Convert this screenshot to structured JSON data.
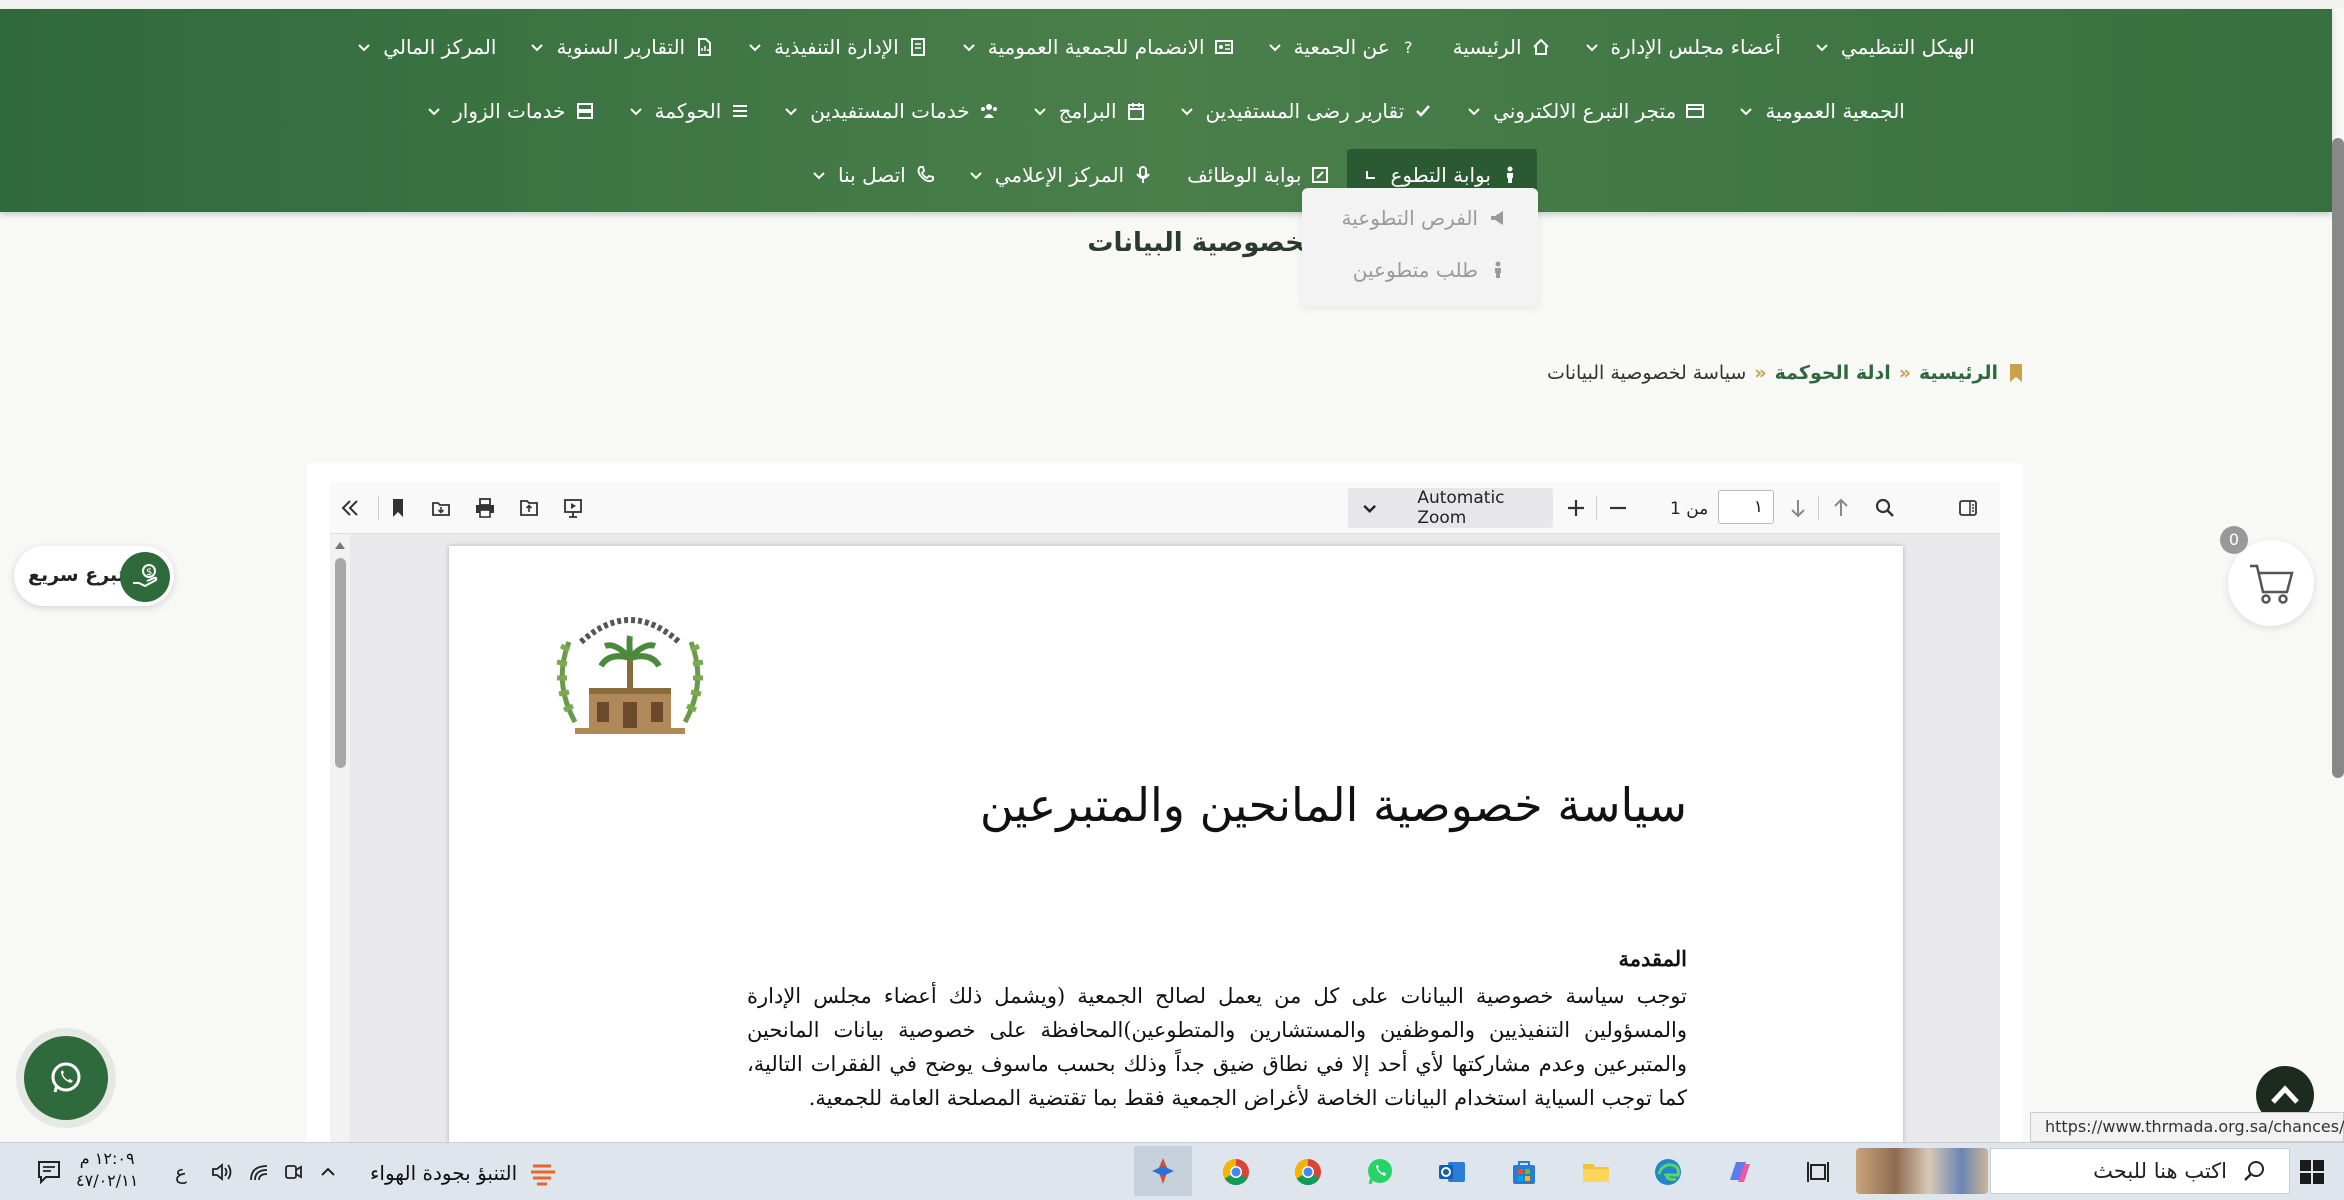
{
  "nav": {
    "row1": [
      {
        "label": "الهيكل التنظيمي",
        "icon": "none",
        "chevron": true
      },
      {
        "label": "أعضاء مجلس الإدارة",
        "icon": "none",
        "chevron": true
      },
      {
        "label": "الرئيسية",
        "icon": "home-icon",
        "chevron": false
      },
      {
        "label": "عن الجمعية",
        "icon": "question-icon",
        "chevron": true
      },
      {
        "label": "الانضمام للجمعية العمومية",
        "icon": "id-card-icon",
        "chevron": true
      },
      {
        "label": "الإدارة التنفيذية",
        "icon": "document-icon",
        "chevron": true
      },
      {
        "label": "التقارير السنوية",
        "icon": "report-icon",
        "chevron": true
      },
      {
        "label": "المركز المالي",
        "icon": "none",
        "chevron": true
      }
    ],
    "row2": [
      {
        "label": "الجمعية العمومية",
        "icon": "none",
        "chevron": true
      },
      {
        "label": "متجر التبرع الالكتروني",
        "icon": "card-icon",
        "chevron": true
      },
      {
        "label": "تقارير رضى المستفيدين",
        "icon": "check-icon",
        "chevron": true
      },
      {
        "label": "البرامج",
        "icon": "calendar-icon",
        "chevron": true
      },
      {
        "label": "خدمات المستفيدين",
        "icon": "users-icon",
        "chevron": true
      },
      {
        "label": "الحوكمة",
        "icon": "list-icon",
        "chevron": true
      },
      {
        "label": "خدمات الزوار",
        "icon": "server-icon",
        "chevron": true
      }
    ],
    "row3": [
      {
        "label": "بوابة التطوع",
        "icon": "person-icon",
        "chevron": true,
        "active": true
      },
      {
        "label": "بوابة الوظائف",
        "icon": "edit-icon",
        "chevron": false
      },
      {
        "label": "المركز الإعلامي",
        "icon": "mic-icon",
        "chevron": true
      },
      {
        "label": "اتصل بنا",
        "icon": "phone-icon",
        "chevron": true
      }
    ]
  },
  "dropdown": {
    "items": [
      "الفرص التطوعية",
      "طلب متطوعين"
    ]
  },
  "page_title": "سياسة لخصوصية البيانات",
  "breadcrumb": {
    "home": "الرئيسية",
    "parent": "ادلة الحوكمة",
    "current": "سياسة لخصوصية البيانات",
    "separator": "»"
  },
  "pdf_toolbar": {
    "zoom_label": "Automatic Zoom",
    "page_number": "١",
    "page_of": "من 1"
  },
  "pdf_page": {
    "title": "سياسة خصوصية المانحين والمتبرعين",
    "heading": "المقدمة",
    "body": "توجب سياسة خصوصية البيانات على كل من يعمل لصالح الجمعية (ويشمل ذلك أعضاء مجلس الإدارة والمسؤولين التنفيذيين والموظفين والمستشارين والمتطوعين)المحافظة على خصوصية بيانات المانحين والمتبرعين وعدم مشاركتها لأي أحد إلا في نطاق ضيق جداً وذلك بحسب ماسوف يوضح في الفقرات التالية، كما توجب السياية استخدام البيانات الخاصة لأغراض الجمعية فقط بما تقتضية المصلحة العامة للجمعية."
  },
  "widgets": {
    "quick_donate": "تبرع سريع",
    "cart_count": "0",
    "status_url": "https://www.thrmada.org.sa/chances/"
  },
  "taskbar": {
    "search_placeholder": "اكتب هنا للبحث",
    "weather": "التنبؤ بجودة الهواء",
    "time": "١٢:٠٩ م",
    "date": "٤٧/٠٢/١١",
    "lang": "ع"
  },
  "colors": {
    "nav_green": "#3d7544",
    "accent_gold": "#c9a24a",
    "dark_green": "#2f6a3c"
  }
}
